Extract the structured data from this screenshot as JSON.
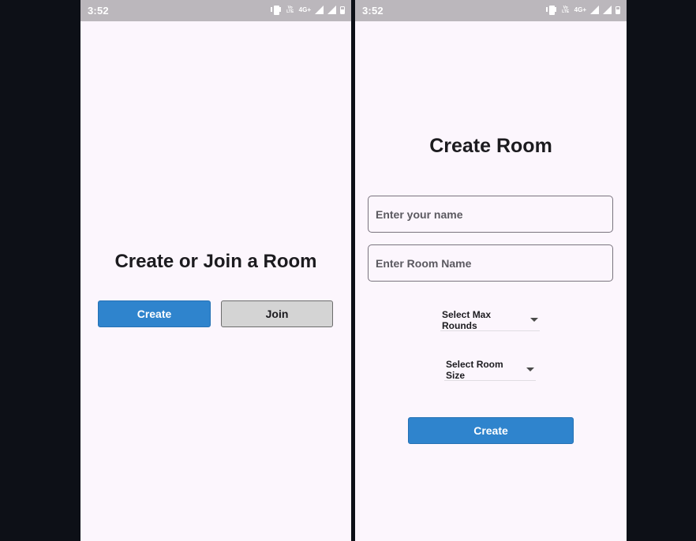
{
  "left_screen": {
    "status_bar": {
      "time": "3:52",
      "net_label": "4G+",
      "volte_label": "Vo LTE"
    },
    "title": "Create or Join a Room",
    "create_button": "Create",
    "join_button": "Join"
  },
  "right_screen": {
    "status_bar": {
      "time": "3:52",
      "net_label": "4G+",
      "volte_label": "Vo LTE"
    },
    "title": "Create Room",
    "name_field": {
      "placeholder": "Enter your name",
      "value": ""
    },
    "room_field": {
      "placeholder": "Enter Room Name",
      "value": ""
    },
    "max_rounds_dropdown": "Select Max Rounds",
    "room_size_dropdown": "Select Room Size",
    "create_button": "Create"
  },
  "icons": [
    "vibrate-icon",
    "signal-icon",
    "battery-icon",
    "caret-down-icon"
  ],
  "colors": {
    "primary_button": "#2f84cd",
    "secondary_button": "#d4d4d4",
    "screen_background": "#fcf6fd",
    "status_bar": "#bbb7bc",
    "outer_background": "#0d1017"
  }
}
